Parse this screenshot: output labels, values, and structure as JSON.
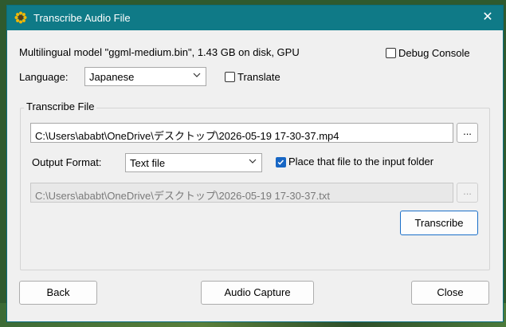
{
  "window": {
    "title": "Transcribe Audio File",
    "close_glyph": "✕",
    "titlebar_color": "#0f7a87"
  },
  "model_info": "Multilingual model \"ggml-medium.bin\", 1.43 GB on disk, GPU",
  "debug_console": {
    "label": "Debug Console",
    "checked": false
  },
  "language": {
    "label": "Language:",
    "selected": "Japanese"
  },
  "translate": {
    "label": "Translate",
    "checked": false
  },
  "group": {
    "title": "Transcribe File",
    "input_path": "C:\\Users\\ababt\\OneDrive\\デスクトップ\\2026-05-19 17-30-37.mp4",
    "browse_input_label": "...",
    "output_format_label": "Output Format:",
    "output_format_selected": "Text file",
    "place_in_input_folder": {
      "label": "Place that file to the input folder",
      "checked": true
    },
    "output_path": "C:\\Users\\ababt\\OneDrive\\デスクトップ\\2026-05-19 17-30-37.txt",
    "browse_output_label": "...",
    "transcribe_label": "Transcribe"
  },
  "footer": {
    "back_label": "Back",
    "audio_capture_label": "Audio Capture",
    "close_label": "Close"
  },
  "icons": {
    "title": "sunflower-icon",
    "dropdown": "chevron-down-icon",
    "check": "checkmark-icon"
  }
}
